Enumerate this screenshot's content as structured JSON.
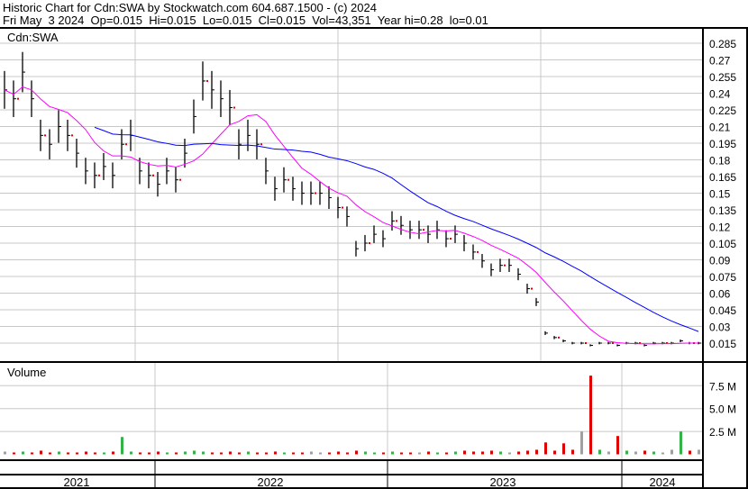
{
  "header": {
    "title": "Historic Chart for Cdn:SWA by Stockwatch.com 604.687.1500 - (c) 2024",
    "quote": "Fri May  3 2024  Op=0.015  Hi=0.015  Lo=0.015  Cl=0.015  Vol=43,351  Year hi=0.28  lo=0.01"
  },
  "chart_data": {
    "type": "line",
    "symbol": "Cdn:SWA",
    "price_axis": {
      "min": 0.0,
      "max": 0.295,
      "ticks": [
        "0.285",
        "0.27",
        "0.255",
        "0.24",
        "0.225",
        "0.21",
        "0.195",
        "0.18",
        "0.165",
        "0.15",
        "0.135",
        "0.12",
        "0.105",
        "0.09",
        "0.075",
        "0.06",
        "0.045",
        "0.03",
        "0.015"
      ]
    },
    "volume_label": "Volume",
    "volume_axis": {
      "ticks": [
        "7.5 M",
        "5.0 M",
        "2.5 M"
      ],
      "tick_values": [
        7.5,
        5.0,
        2.5
      ]
    },
    "years": [
      "2021",
      "2022",
      "2023",
      "2024"
    ],
    "closes": [
      0.243,
      0.235,
      0.259,
      0.235,
      0.202,
      0.194,
      0.21,
      0.202,
      0.186,
      0.17,
      0.166,
      0.174,
      0.166,
      0.194,
      0.202,
      0.17,
      0.166,
      0.158,
      0.17,
      0.162,
      0.186,
      0.219,
      0.251,
      0.243,
      0.235,
      0.227,
      0.194,
      0.202,
      0.194,
      0.17,
      0.154,
      0.162,
      0.154,
      0.15,
      0.15,
      0.15,
      0.146,
      0.137,
      0.129,
      0.1,
      0.105,
      0.113,
      0.109,
      0.125,
      0.121,
      0.117,
      0.117,
      0.113,
      0.117,
      0.109,
      0.113,
      0.105,
      0.097,
      0.089,
      0.081,
      0.085,
      0.085,
      0.077,
      0.064,
      0.052,
      0.024,
      0.02,
      0.017,
      0.015,
      0.015,
      0.013,
      0.015,
      0.015,
      0.013,
      0.015,
      0.015,
      0.013,
      0.015,
      0.015,
      0.015,
      0.017,
      0.015,
      0.015
    ],
    "volumes_m": [
      0.3,
      0.2,
      0.3,
      0.2,
      0.4,
      0.2,
      0.3,
      0.2,
      0.2,
      0.3,
      0.2,
      0.2,
      0.3,
      1.9,
      0.3,
      0.2,
      0.2,
      0.3,
      0.2,
      0.2,
      0.3,
      0.4,
      0.3,
      0.2,
      0.2,
      0.3,
      0.2,
      0.3,
      0.2,
      0.2,
      0.3,
      0.2,
      0.2,
      0.2,
      0.3,
      0.2,
      0.2,
      0.3,
      0.2,
      0.4,
      0.3,
      0.2,
      0.2,
      0.3,
      0.2,
      0.2,
      0.2,
      0.3,
      0.2,
      0.2,
      0.3,
      0.4,
      0.3,
      0.3,
      0.4,
      0.3,
      0.2,
      0.3,
      0.4,
      0.5,
      1.3,
      0.4,
      1.2,
      0.5,
      2.5,
      8.6,
      0.5,
      0.3,
      2.0,
      0.4,
      0.3,
      0.4,
      0.3,
      0.2,
      0.5,
      2.5,
      0.4,
      0.5
    ],
    "series": [
      {
        "name": "Price (high-low bars)",
        "color": "#000000"
      },
      {
        "name": "Short moving average",
        "color": "#ff00ff",
        "window": 8
      },
      {
        "name": "Long moving average",
        "color": "#0000ff",
        "window": 22
      }
    ],
    "colors": {
      "up": "#33b24a",
      "down": "#e00000",
      "flat": "#a0a0a0",
      "grid": "#c8c8c8"
    }
  }
}
